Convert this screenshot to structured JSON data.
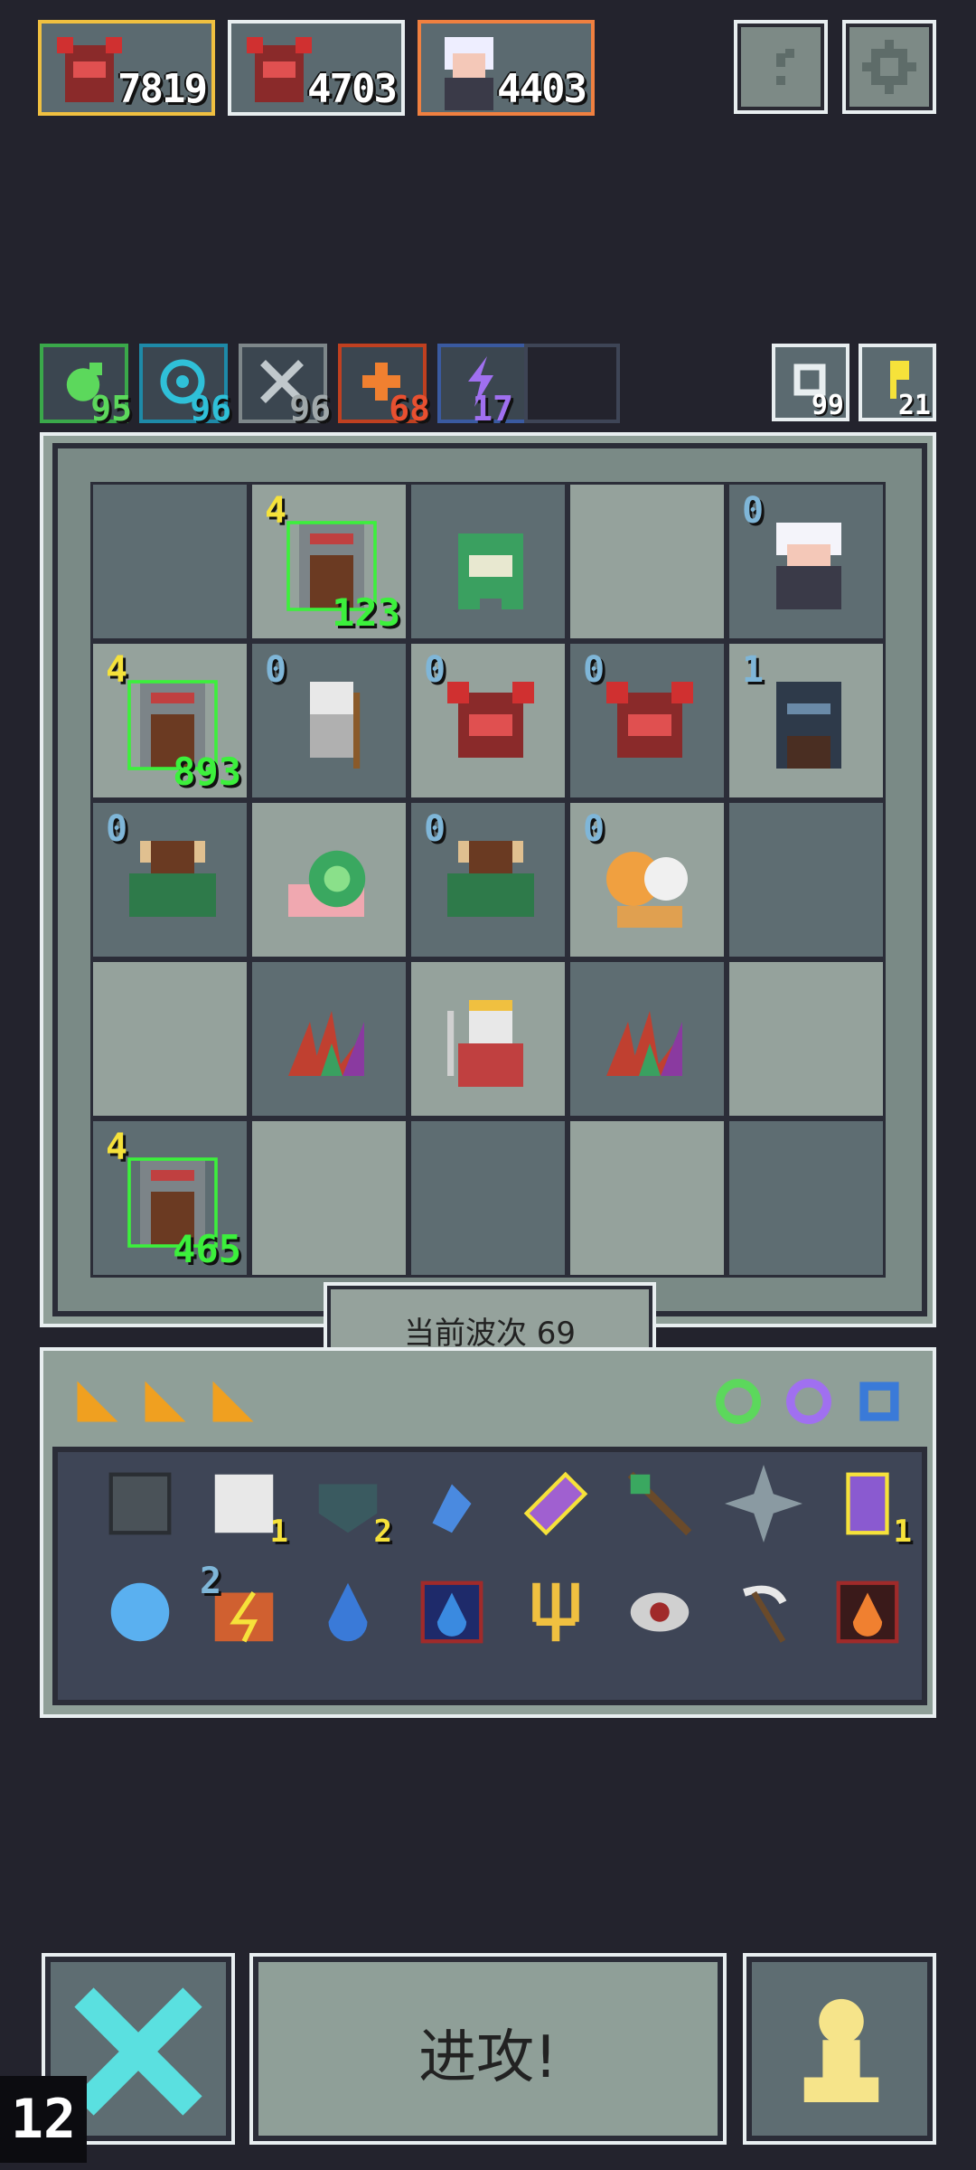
{
  "heroes": [
    {
      "name": "red-dragon",
      "hp": "7819",
      "border": "#f0c040"
    },
    {
      "name": "red-dragon",
      "hp": "4703",
      "border": "#e8eef0"
    },
    {
      "name": "white-haired-mage",
      "hp": "4403",
      "border": "#f08040"
    }
  ],
  "top_buttons": {
    "help_icon": "question-icon",
    "settings_icon": "gear-icon"
  },
  "resources": [
    {
      "icon": "green-orb-icon",
      "value": "95",
      "color": "#5cd85c"
    },
    {
      "icon": "swirl-icon",
      "value": "96",
      "color": "#2fc0d8"
    },
    {
      "icon": "crossed-swords-icon",
      "value": "96",
      "color": "#a0a8aa"
    },
    {
      "icon": "fire-cross-icon",
      "value": "68",
      "color": "#e85030"
    },
    {
      "icon": "lightning-icon",
      "value": "17",
      "color": "#a070f0"
    }
  ],
  "side_resources": [
    {
      "icon": "refresh-icon",
      "value": "99"
    },
    {
      "icon": "key-icon",
      "value": "21"
    }
  ],
  "board": [
    [
      null,
      {
        "unit": "stone-wall",
        "lvl": "4",
        "lvlColor": "y",
        "count": "123"
      },
      {
        "unit": "green-dragon"
      },
      null,
      {
        "unit": "white-haired-mage",
        "lvl": "0",
        "lvlColor": "b"
      }
    ],
    [
      {
        "unit": "stone-wall",
        "lvl": "4",
        "lvlColor": "y",
        "count": "893"
      },
      {
        "unit": "white-beast-warrior",
        "lvl": "0",
        "lvlColor": "b"
      },
      {
        "unit": "red-dragon",
        "lvl": "0",
        "lvlColor": "b"
      },
      {
        "unit": "red-dragon",
        "lvl": "0",
        "lvlColor": "b"
      },
      {
        "unit": "dark-knight",
        "lvl": "1",
        "lvlColor": "b"
      }
    ],
    [
      {
        "unit": "minotaur",
        "lvl": "0",
        "lvlColor": "b"
      },
      {
        "unit": "snail"
      },
      {
        "unit": "minotaur",
        "lvl": "0",
        "lvlColor": "b"
      },
      {
        "unit": "lion-pair",
        "lvl": "0",
        "lvlColor": "b"
      },
      null
    ],
    [
      null,
      {
        "unit": "crystal-plant"
      },
      {
        "unit": "skeleton-king"
      },
      {
        "unit": "crystal-plant"
      },
      null
    ],
    [
      {
        "unit": "stone-wall",
        "lvl": "4",
        "lvlColor": "y",
        "count": "465"
      },
      null,
      null,
      null,
      null
    ]
  ],
  "wave": {
    "label": "当前波次 69"
  },
  "inventory_tabs": {
    "cards": [
      "card-icon",
      "card-icon",
      "card-icon"
    ],
    "gems": [
      "green-gem-icon",
      "purple-gem-icon",
      "blue-gem-icon"
    ]
  },
  "items": [
    {
      "icon": "metal-box-icon",
      "qty": ""
    },
    {
      "icon": "scroll-icon",
      "qty": "1"
    },
    {
      "icon": "heart-shield-icon",
      "qty": "2"
    },
    {
      "icon": "blue-bird-icon",
      "qty": ""
    },
    {
      "icon": "purple-key-icon",
      "qty": ""
    },
    {
      "icon": "green-arrow-icon",
      "qty": ""
    },
    {
      "icon": "shuriken-icon",
      "qty": ""
    },
    {
      "icon": "potion-jar-icon",
      "qty": "1"
    },
    {
      "icon": "blue-orb-icon",
      "qty": ""
    },
    {
      "icon": "lightning-book-icon",
      "qty": "",
      "lvl": "2"
    },
    {
      "icon": "water-drop-icon",
      "qty": ""
    },
    {
      "icon": "water-rune-icon",
      "qty": ""
    },
    {
      "icon": "gold-trident-icon",
      "qty": ""
    },
    {
      "icon": "red-eye-icon",
      "qty": ""
    },
    {
      "icon": "scythe-icon",
      "qty": ""
    },
    {
      "icon": "fire-rune-icon",
      "qty": ""
    }
  ],
  "bottom": {
    "attack_label": "进攻!",
    "turn": "12",
    "cancel_icon": "x-icon",
    "pawn_icon": "pawn-icon"
  }
}
